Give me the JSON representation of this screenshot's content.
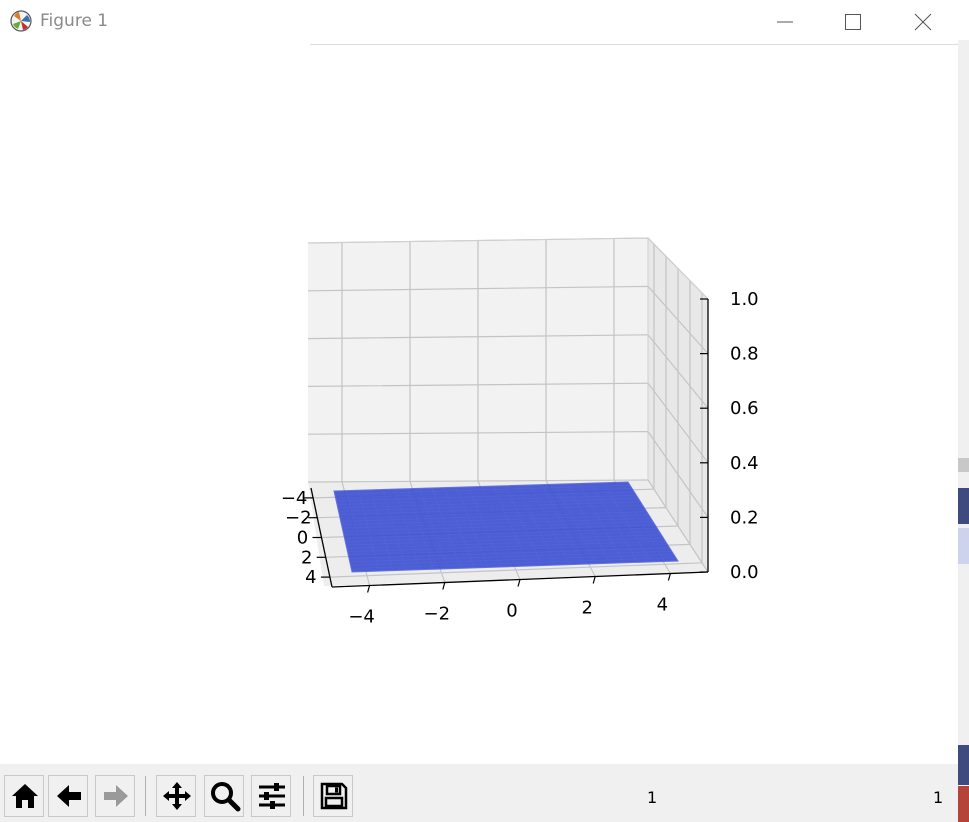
{
  "window": {
    "title": "Figure 1"
  },
  "chart_data": {
    "type": "surface",
    "title": "",
    "xlabel": "",
    "ylabel": "",
    "zlabel": "",
    "x_ticks": [
      "−4",
      "−2",
      "0",
      "2",
      "4"
    ],
    "y_ticks": [
      "−4",
      "−2",
      "0",
      "2",
      "4"
    ],
    "z_ticks": [
      "0.0",
      "0.2",
      "0.4",
      "0.6",
      "0.8",
      "1.0"
    ],
    "x_range": [
      -5,
      5
    ],
    "y_range": [
      -5,
      5
    ],
    "z_range": [
      0,
      1
    ],
    "surface_z": 0,
    "surface_color": "#3b4fd0",
    "grid": true
  },
  "toolbar": {
    "buttons": [
      "home",
      "back",
      "forward",
      "pan",
      "zoom",
      "configure",
      "save"
    ],
    "status_left": "1",
    "status_right": "1"
  }
}
